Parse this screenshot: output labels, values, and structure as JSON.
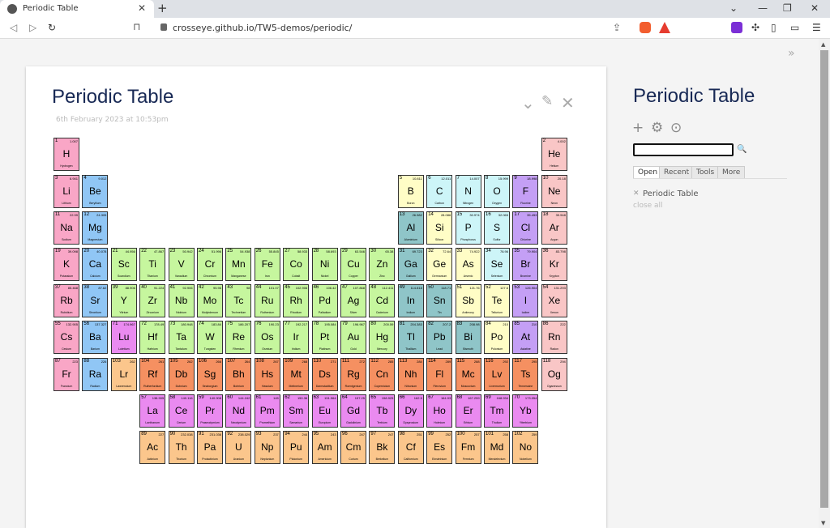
{
  "browser": {
    "tab_title": "Periodic Table",
    "url": "crosseye.github.io/TW5-demos/periodic/"
  },
  "tiddler": {
    "title": "Periodic Table",
    "date": "6th February 2023 at 10:53pm"
  },
  "sidebar": {
    "title": "Periodic Table",
    "tabs": [
      "Open",
      "Recent",
      "Tools",
      "More"
    ],
    "open_item": "Periodic Table",
    "close_all": "close all"
  },
  "colors": {
    "alkali": "#f9a6c6",
    "alkaline": "#90c6f5",
    "transition": "#c6f69e",
    "post_transition": "#8fc5c8",
    "metalloid": "#fffdc6",
    "nonmetal": "#cdf5f8",
    "halogen": "#c49ff5",
    "noble": "#f9c6c6",
    "lanthanide": "#ea8af0",
    "actinide": "#fbc68c",
    "unknown": "#f59061"
  },
  "elements": [
    {
      "n": 1,
      "s": "H",
      "name": "Hydrogen",
      "m": "1.007",
      "r": 1,
      "c": 1,
      "g": "alkali"
    },
    {
      "n": 2,
      "s": "He",
      "name": "Helium",
      "m": "4.002",
      "r": 1,
      "c": 18,
      "g": "noble"
    },
    {
      "n": 3,
      "s": "Li",
      "name": "Lithium",
      "m": "6.941",
      "r": 2,
      "c": 1,
      "g": "alkali"
    },
    {
      "n": 4,
      "s": "Be",
      "name": "Beryllium",
      "m": "9.012",
      "r": 2,
      "c": 2,
      "g": "alkaline"
    },
    {
      "n": 5,
      "s": "B",
      "name": "Boron",
      "m": "10.811",
      "r": 2,
      "c": 13,
      "g": "metalloid"
    },
    {
      "n": 6,
      "s": "C",
      "name": "Carbon",
      "m": "12.011",
      "r": 2,
      "c": 14,
      "g": "nonmetal"
    },
    {
      "n": 7,
      "s": "N",
      "name": "Nitrogen",
      "m": "14.007",
      "r": 2,
      "c": 15,
      "g": "nonmetal"
    },
    {
      "n": 8,
      "s": "O",
      "name": "Oxygen",
      "m": "15.999",
      "r": 2,
      "c": 16,
      "g": "nonmetal"
    },
    {
      "n": 9,
      "s": "F",
      "name": "Fluorine",
      "m": "18.998",
      "r": 2,
      "c": 17,
      "g": "halogen"
    },
    {
      "n": 10,
      "s": "Ne",
      "name": "Neon",
      "m": "20.18",
      "r": 2,
      "c": 18,
      "g": "noble"
    },
    {
      "n": 11,
      "s": "Na",
      "name": "Sodium",
      "m": "22.99",
      "r": 3,
      "c": 1,
      "g": "alkali"
    },
    {
      "n": 12,
      "s": "Mg",
      "name": "Magnesium",
      "m": "24.305",
      "r": 3,
      "c": 2,
      "g": "alkaline"
    },
    {
      "n": 13,
      "s": "Al",
      "name": "Aluminium",
      "m": "26.982",
      "r": 3,
      "c": 13,
      "g": "post_transition"
    },
    {
      "n": 14,
      "s": "Si",
      "name": "Silicon",
      "m": "28.086",
      "r": 3,
      "c": 14,
      "g": "metalloid"
    },
    {
      "n": 15,
      "s": "P",
      "name": "Phosphorus",
      "m": "30.974",
      "r": 3,
      "c": 15,
      "g": "nonmetal"
    },
    {
      "n": 16,
      "s": "S",
      "name": "Sulfur",
      "m": "32.065",
      "r": 3,
      "c": 16,
      "g": "nonmetal"
    },
    {
      "n": 17,
      "s": "Cl",
      "name": "Chlorine",
      "m": "35.453",
      "r": 3,
      "c": 17,
      "g": "halogen"
    },
    {
      "n": 18,
      "s": "Ar",
      "name": "Argon",
      "m": "39.948",
      "r": 3,
      "c": 18,
      "g": "noble"
    },
    {
      "n": 19,
      "s": "K",
      "name": "Potassium",
      "m": "39.098",
      "r": 4,
      "c": 1,
      "g": "alkali"
    },
    {
      "n": 20,
      "s": "Ca",
      "name": "Calcium",
      "m": "40.078",
      "r": 4,
      "c": 2,
      "g": "alkaline"
    },
    {
      "n": 21,
      "s": "Sc",
      "name": "Scandium",
      "m": "44.956",
      "r": 4,
      "c": 3,
      "g": "transition"
    },
    {
      "n": 22,
      "s": "Ti",
      "name": "Titanium",
      "m": "47.867",
      "r": 4,
      "c": 4,
      "g": "transition"
    },
    {
      "n": 23,
      "s": "V",
      "name": "Vanadium",
      "m": "50.942",
      "r": 4,
      "c": 5,
      "g": "transition"
    },
    {
      "n": 24,
      "s": "Cr",
      "name": "Chromium",
      "m": "51.996",
      "r": 4,
      "c": 6,
      "g": "transition"
    },
    {
      "n": 25,
      "s": "Mn",
      "name": "Manganese",
      "m": "54.938",
      "r": 4,
      "c": 7,
      "g": "transition"
    },
    {
      "n": 26,
      "s": "Fe",
      "name": "Iron",
      "m": "55.845",
      "r": 4,
      "c": 8,
      "g": "transition"
    },
    {
      "n": 27,
      "s": "Co",
      "name": "Cobalt",
      "m": "58.933",
      "r": 4,
      "c": 9,
      "g": "transition"
    },
    {
      "n": 28,
      "s": "Ni",
      "name": "Nickel",
      "m": "58.693",
      "r": 4,
      "c": 10,
      "g": "transition"
    },
    {
      "n": 29,
      "s": "Cu",
      "name": "Copper",
      "m": "63.546",
      "r": 4,
      "c": 11,
      "g": "transition"
    },
    {
      "n": 30,
      "s": "Zn",
      "name": "Zinc",
      "m": "65.38",
      "r": 4,
      "c": 12,
      "g": "transition"
    },
    {
      "n": 31,
      "s": "Ga",
      "name": "Gallium",
      "m": "69.723",
      "r": 4,
      "c": 13,
      "g": "post_transition"
    },
    {
      "n": 32,
      "s": "Ge",
      "name": "Germanium",
      "m": "72.64",
      "r": 4,
      "c": 14,
      "g": "metalloid"
    },
    {
      "n": 33,
      "s": "As",
      "name": "Arsenic",
      "m": "74.922",
      "r": 4,
      "c": 15,
      "g": "metalloid"
    },
    {
      "n": 34,
      "s": "Se",
      "name": "Selenium",
      "m": "78.96",
      "r": 4,
      "c": 16,
      "g": "nonmetal"
    },
    {
      "n": 35,
      "s": "Br",
      "name": "Bromine",
      "m": "79.904",
      "r": 4,
      "c": 17,
      "g": "halogen"
    },
    {
      "n": 36,
      "s": "Kr",
      "name": "Krypton",
      "m": "83.798",
      "r": 4,
      "c": 18,
      "g": "noble"
    },
    {
      "n": 37,
      "s": "Rb",
      "name": "Rubidium",
      "m": "85.468",
      "r": 5,
      "c": 1,
      "g": "alkali"
    },
    {
      "n": 38,
      "s": "Sr",
      "name": "Strontium",
      "m": "87.62",
      "r": 5,
      "c": 2,
      "g": "alkaline"
    },
    {
      "n": 39,
      "s": "Y",
      "name": "Yttrium",
      "m": "88.906",
      "r": 5,
      "c": 3,
      "g": "transition"
    },
    {
      "n": 40,
      "s": "Zr",
      "name": "Zirconium",
      "m": "91.224",
      "r": 5,
      "c": 4,
      "g": "transition"
    },
    {
      "n": 41,
      "s": "Nb",
      "name": "Niobium",
      "m": "92.906",
      "r": 5,
      "c": 5,
      "g": "transition"
    },
    {
      "n": 42,
      "s": "Mo",
      "name": "Molybdenum",
      "m": "95.96",
      "r": 5,
      "c": 6,
      "g": "transition"
    },
    {
      "n": 43,
      "s": "Tc",
      "name": "Technetium",
      "m": "98",
      "r": 5,
      "c": 7,
      "g": "transition"
    },
    {
      "n": 44,
      "s": "Ru",
      "name": "Ruthenium",
      "m": "101.07",
      "r": 5,
      "c": 8,
      "g": "transition"
    },
    {
      "n": 45,
      "s": "Rh",
      "name": "Rhodium",
      "m": "102.906",
      "r": 5,
      "c": 9,
      "g": "transition"
    },
    {
      "n": 46,
      "s": "Pd",
      "name": "Palladium",
      "m": "106.42",
      "r": 5,
      "c": 10,
      "g": "transition"
    },
    {
      "n": 47,
      "s": "Ag",
      "name": "Silver",
      "m": "107.868",
      "r": 5,
      "c": 11,
      "g": "transition"
    },
    {
      "n": 48,
      "s": "Cd",
      "name": "Cadmium",
      "m": "112.411",
      "r": 5,
      "c": 12,
      "g": "transition"
    },
    {
      "n": 49,
      "s": "In",
      "name": "Indium",
      "m": "114.818",
      "r": 5,
      "c": 13,
      "g": "post_transition"
    },
    {
      "n": 50,
      "s": "Sn",
      "name": "Tin",
      "m": "118.71",
      "r": 5,
      "c": 14,
      "g": "post_transition"
    },
    {
      "n": 51,
      "s": "Sb",
      "name": "Antimony",
      "m": "121.76",
      "r": 5,
      "c": 15,
      "g": "metalloid"
    },
    {
      "n": 52,
      "s": "Te",
      "name": "Tellurium",
      "m": "127.6",
      "r": 5,
      "c": 16,
      "g": "metalloid"
    },
    {
      "n": 53,
      "s": "I",
      "name": "Iodine",
      "m": "126.904",
      "r": 5,
      "c": 17,
      "g": "halogen"
    },
    {
      "n": 54,
      "s": "Xe",
      "name": "Xenon",
      "m": "131.293",
      "r": 5,
      "c": 18,
      "g": "noble"
    },
    {
      "n": 55,
      "s": "Cs",
      "name": "Cesium",
      "m": "132.905",
      "r": 6,
      "c": 1,
      "g": "alkali"
    },
    {
      "n": 56,
      "s": "Ba",
      "name": "Barium",
      "m": "137.327",
      "r": 6,
      "c": 2,
      "g": "alkaline"
    },
    {
      "n": 71,
      "s": "Lu",
      "name": "Lutetium",
      "m": "174.967",
      "r": 6,
      "c": 3,
      "g": "lanthanide"
    },
    {
      "n": 72,
      "s": "Hf",
      "name": "Hafnium",
      "m": "178.49",
      "r": 6,
      "c": 4,
      "g": "transition"
    },
    {
      "n": 73,
      "s": "Ta",
      "name": "Tantalum",
      "m": "180.948",
      "r": 6,
      "c": 5,
      "g": "transition"
    },
    {
      "n": 74,
      "s": "W",
      "name": "Tungsten",
      "m": "183.84",
      "r": 6,
      "c": 6,
      "g": "transition"
    },
    {
      "n": 75,
      "s": "Re",
      "name": "Rhenium",
      "m": "186.207",
      "r": 6,
      "c": 7,
      "g": "transition"
    },
    {
      "n": 76,
      "s": "Os",
      "name": "Osmium",
      "m": "190.23",
      "r": 6,
      "c": 8,
      "g": "transition"
    },
    {
      "n": 77,
      "s": "Ir",
      "name": "Iridium",
      "m": "192.217",
      "r": 6,
      "c": 9,
      "g": "transition"
    },
    {
      "n": 78,
      "s": "Pt",
      "name": "Platinum",
      "m": "195.084",
      "r": 6,
      "c": 10,
      "g": "transition"
    },
    {
      "n": 79,
      "s": "Au",
      "name": "Gold",
      "m": "196.967",
      "r": 6,
      "c": 11,
      "g": "transition"
    },
    {
      "n": 80,
      "s": "Hg",
      "name": "Mercury",
      "m": "200.59",
      "r": 6,
      "c": 12,
      "g": "transition"
    },
    {
      "n": 81,
      "s": "Tl",
      "name": "Thallium",
      "m": "204.383",
      "r": 6,
      "c": 13,
      "g": "post_transition"
    },
    {
      "n": 82,
      "s": "Pb",
      "name": "Lead",
      "m": "207.2",
      "r": 6,
      "c": 14,
      "g": "post_transition"
    },
    {
      "n": 83,
      "s": "Bi",
      "name": "Bismuth",
      "m": "208.98",
      "r": 6,
      "c": 15,
      "g": "post_transition"
    },
    {
      "n": 84,
      "s": "Po",
      "name": "Polonium",
      "m": "210",
      "r": 6,
      "c": 16,
      "g": "metalloid"
    },
    {
      "n": 85,
      "s": "At",
      "name": "Astatine",
      "m": "210",
      "r": 6,
      "c": 17,
      "g": "halogen"
    },
    {
      "n": 86,
      "s": "Rn",
      "name": "Radon",
      "m": "222",
      "r": 6,
      "c": 18,
      "g": "noble"
    },
    {
      "n": 87,
      "s": "Fr",
      "name": "Francium",
      "m": "223",
      "r": 7,
      "c": 1,
      "g": "alkali"
    },
    {
      "n": 88,
      "s": "Ra",
      "name": "Radium",
      "m": "226",
      "r": 7,
      "c": 2,
      "g": "alkaline"
    },
    {
      "n": 103,
      "s": "Lr",
      "name": "Lawrencium",
      "m": "262",
      "r": 7,
      "c": 3,
      "g": "actinide"
    },
    {
      "n": 104,
      "s": "Rf",
      "name": "Rutherfordium",
      "m": "261",
      "r": 7,
      "c": 4,
      "g": "unknown"
    },
    {
      "n": 105,
      "s": "Db",
      "name": "Dubnium",
      "m": "262",
      "r": 7,
      "c": 5,
      "g": "unknown"
    },
    {
      "n": 106,
      "s": "Sg",
      "name": "Seaborgium",
      "m": "266",
      "r": 7,
      "c": 6,
      "g": "unknown"
    },
    {
      "n": 107,
      "s": "Bh",
      "name": "Bohrium",
      "m": "264",
      "r": 7,
      "c": 7,
      "g": "unknown"
    },
    {
      "n": 108,
      "s": "Hs",
      "name": "Hassium",
      "m": "267",
      "r": 7,
      "c": 8,
      "g": "unknown"
    },
    {
      "n": 109,
      "s": "Mt",
      "name": "Meitnerium",
      "m": "268",
      "r": 7,
      "c": 9,
      "g": "unknown"
    },
    {
      "n": 110,
      "s": "Ds",
      "name": "Darmstadtium",
      "m": "271",
      "r": 7,
      "c": 10,
      "g": "unknown"
    },
    {
      "n": 111,
      "s": "Rg",
      "name": "Roentgenium",
      "m": "272",
      "r": 7,
      "c": 11,
      "g": "unknown"
    },
    {
      "n": 112,
      "s": "Cn",
      "name": "Copernicium",
      "m": "285",
      "r": 7,
      "c": 12,
      "g": "unknown"
    },
    {
      "n": 113,
      "s": "Nh",
      "name": "Nihonium",
      "m": "284",
      "r": 7,
      "c": 13,
      "g": "unknown"
    },
    {
      "n": 114,
      "s": "Fl",
      "name": "Flerovium",
      "m": "289",
      "r": 7,
      "c": 14,
      "g": "unknown"
    },
    {
      "n": 115,
      "s": "Mc",
      "name": "Moscovium",
      "m": "288",
      "r": 7,
      "c": 15,
      "g": "unknown"
    },
    {
      "n": 116,
      "s": "Lv",
      "name": "Livermorium",
      "m": "292",
      "r": 7,
      "c": 16,
      "g": "unknown"
    },
    {
      "n": 117,
      "s": "Ts",
      "name": "Tennessine",
      "m": "295",
      "r": 7,
      "c": 17,
      "g": "unknown"
    },
    {
      "n": 118,
      "s": "Og",
      "name": "Oganesson",
      "m": "294",
      "r": 7,
      "c": 18,
      "g": "noble"
    },
    {
      "n": 57,
      "s": "La",
      "name": "Lanthanum",
      "m": "138.905",
      "r": 8,
      "c": 4,
      "g": "lanthanide"
    },
    {
      "n": 58,
      "s": "Ce",
      "name": "Cerium",
      "m": "140.116",
      "r": 8,
      "c": 5,
      "g": "lanthanide"
    },
    {
      "n": 59,
      "s": "Pr",
      "name": "Praseodymium",
      "m": "140.908",
      "r": 8,
      "c": 6,
      "g": "lanthanide"
    },
    {
      "n": 60,
      "s": "Nd",
      "name": "Neodymium",
      "m": "144.242",
      "r": 8,
      "c": 7,
      "g": "lanthanide"
    },
    {
      "n": 61,
      "s": "Pm",
      "name": "Promethium",
      "m": "145",
      "r": 8,
      "c": 8,
      "g": "lanthanide"
    },
    {
      "n": 62,
      "s": "Sm",
      "name": "Samarium",
      "m": "150.36",
      "r": 8,
      "c": 9,
      "g": "lanthanide"
    },
    {
      "n": 63,
      "s": "Eu",
      "name": "Europium",
      "m": "151.964",
      "r": 8,
      "c": 10,
      "g": "lanthanide"
    },
    {
      "n": 64,
      "s": "Gd",
      "name": "Gadolinium",
      "m": "157.25",
      "r": 8,
      "c": 11,
      "g": "lanthanide"
    },
    {
      "n": 65,
      "s": "Tb",
      "name": "Terbium",
      "m": "158.925",
      "r": 8,
      "c": 12,
      "g": "lanthanide"
    },
    {
      "n": 66,
      "s": "Dy",
      "name": "Dysprosium",
      "m": "162.5",
      "r": 8,
      "c": 13,
      "g": "lanthanide"
    },
    {
      "n": 67,
      "s": "Ho",
      "name": "Holmium",
      "m": "164.93",
      "r": 8,
      "c": 14,
      "g": "lanthanide"
    },
    {
      "n": 68,
      "s": "Er",
      "name": "Erbium",
      "m": "167.259",
      "r": 8,
      "c": 15,
      "g": "lanthanide"
    },
    {
      "n": 69,
      "s": "Tm",
      "name": "Thulium",
      "m": "168.934",
      "r": 8,
      "c": 16,
      "g": "lanthanide"
    },
    {
      "n": 70,
      "s": "Yb",
      "name": "Ytterbium",
      "m": "173.054",
      "r": 8,
      "c": 17,
      "g": "lanthanide"
    },
    {
      "n": 89,
      "s": "Ac",
      "name": "Actinium",
      "m": "227",
      "r": 9,
      "c": 4,
      "g": "actinide"
    },
    {
      "n": 90,
      "s": "Th",
      "name": "Thorium",
      "m": "232.038",
      "r": 9,
      "c": 5,
      "g": "actinide"
    },
    {
      "n": 91,
      "s": "Pa",
      "name": "Protactinium",
      "m": "231.036",
      "r": 9,
      "c": 6,
      "g": "actinide"
    },
    {
      "n": 92,
      "s": "U",
      "name": "Uranium",
      "m": "238.029",
      "r": 9,
      "c": 7,
      "g": "actinide"
    },
    {
      "n": 93,
      "s": "Np",
      "name": "Neptunium",
      "m": "237",
      "r": 9,
      "c": 8,
      "g": "actinide"
    },
    {
      "n": 94,
      "s": "Pu",
      "name": "Plutonium",
      "m": "244",
      "r": 9,
      "c": 9,
      "g": "actinide"
    },
    {
      "n": 95,
      "s": "Am",
      "name": "Americium",
      "m": "243",
      "r": 9,
      "c": 10,
      "g": "actinide"
    },
    {
      "n": 96,
      "s": "Cm",
      "name": "Curium",
      "m": "247",
      "r": 9,
      "c": 11,
      "g": "actinide"
    },
    {
      "n": 97,
      "s": "Bk",
      "name": "Berkelium",
      "m": "247",
      "r": 9,
      "c": 12,
      "g": "actinide"
    },
    {
      "n": 98,
      "s": "Cf",
      "name": "Californium",
      "m": "251",
      "r": 9,
      "c": 13,
      "g": "actinide"
    },
    {
      "n": 99,
      "s": "Es",
      "name": "Einsteinium",
      "m": "252",
      "r": 9,
      "c": 14,
      "g": "actinide"
    },
    {
      "n": 100,
      "s": "Fm",
      "name": "Fermium",
      "m": "257",
      "r": 9,
      "c": 15,
      "g": "actinide"
    },
    {
      "n": 101,
      "s": "Md",
      "name": "Mendelevium",
      "m": "258",
      "r": 9,
      "c": 16,
      "g": "actinide"
    },
    {
      "n": 102,
      "s": "No",
      "name": "Nobelium",
      "m": "259",
      "r": 9,
      "c": 17,
      "g": "actinide"
    }
  ]
}
